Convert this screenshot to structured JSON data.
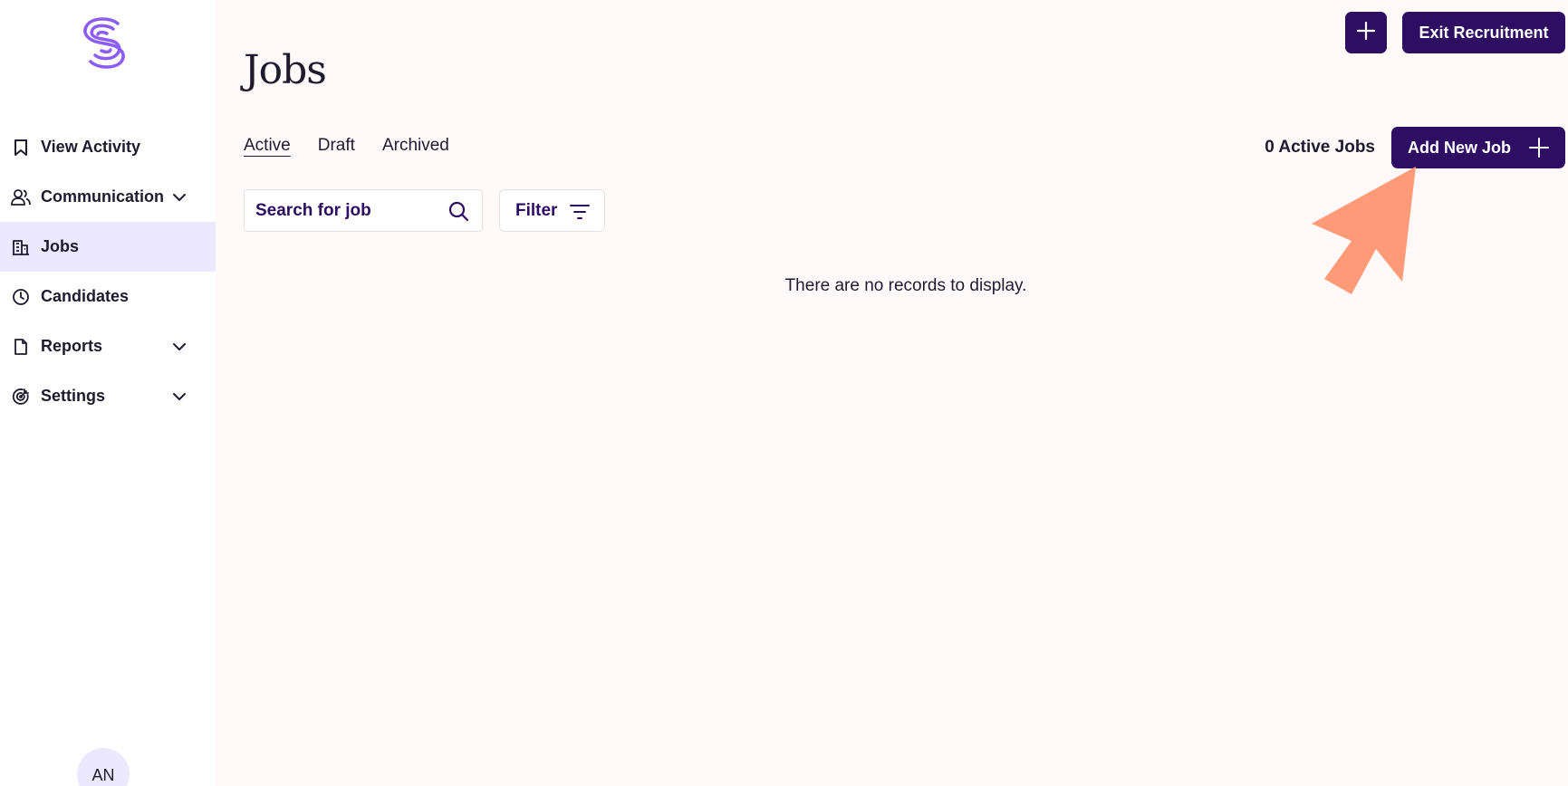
{
  "sidebar": {
    "items": [
      {
        "label": "View Activity",
        "icon": "bookmark-icon"
      },
      {
        "label": "Communication",
        "icon": "users-icon",
        "has_submenu": true
      },
      {
        "label": "Jobs",
        "icon": "building-icon",
        "active": true
      },
      {
        "label": "Candidates",
        "icon": "clock-icon"
      },
      {
        "label": "Reports",
        "icon": "document-icon",
        "has_submenu": true
      },
      {
        "label": "Settings",
        "icon": "target-icon",
        "has_submenu": true
      }
    ],
    "avatar_initials": "AN"
  },
  "header": {
    "title": "Jobs",
    "exit_label": "Exit Recruitment"
  },
  "tabs": [
    {
      "label": "Active",
      "active": true
    },
    {
      "label": "Draft"
    },
    {
      "label": "Archived"
    }
  ],
  "jobs": {
    "active_count_label": "0 Active Jobs",
    "add_label": "Add New Job",
    "empty_message": "There are no records to display."
  },
  "search": {
    "placeholder": "Search for job"
  },
  "filter": {
    "label": "Filter"
  },
  "colors": {
    "primary": "#2e0e63",
    "active_nav_bg": "#ece8fd",
    "logo": "#8b5cf6",
    "pointer": "#ff9a78"
  }
}
